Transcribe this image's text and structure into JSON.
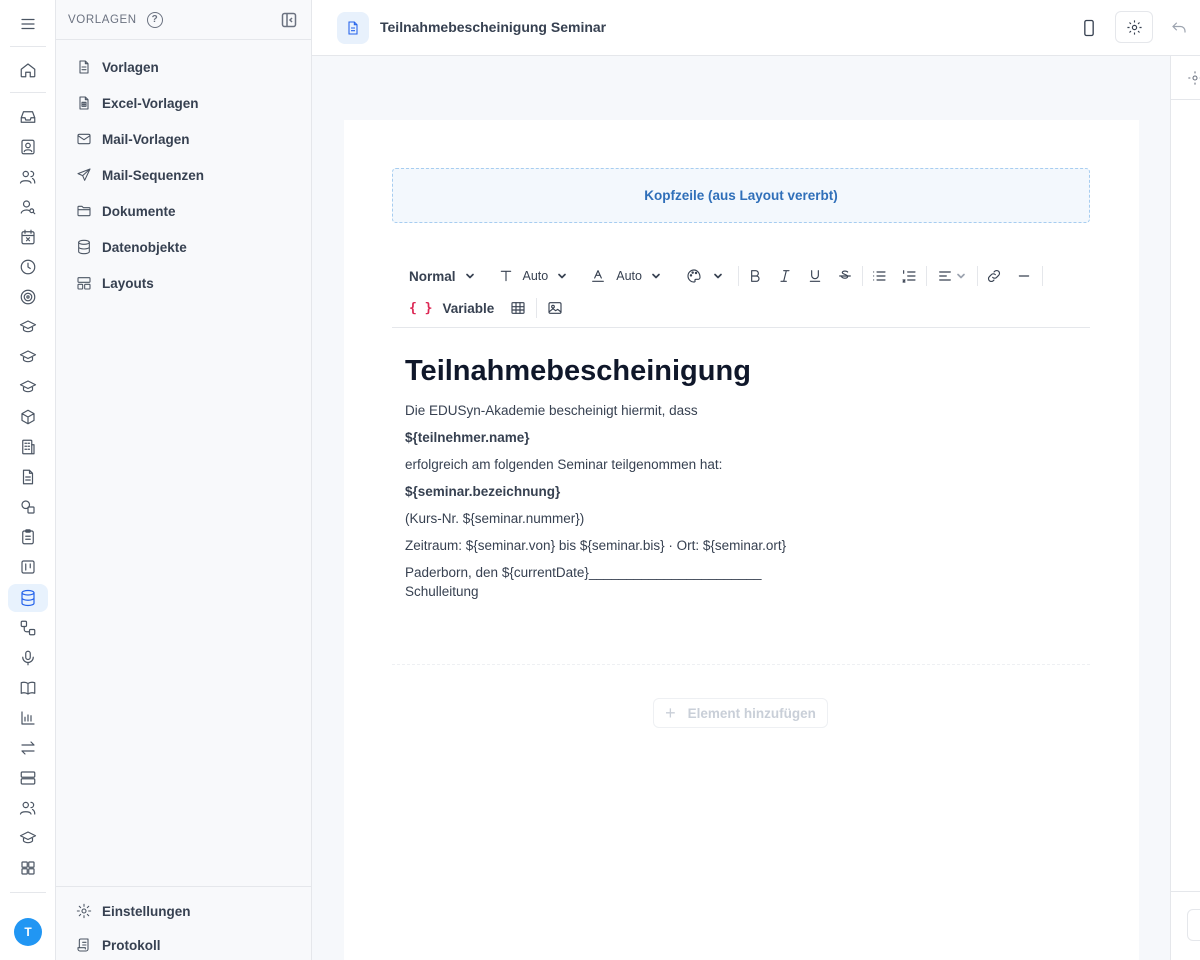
{
  "app": {
    "user_initial": "T"
  },
  "rail": {
    "items": [
      "menu",
      "home",
      "inbox",
      "contacts",
      "users",
      "user-search",
      "calendar",
      "clock",
      "target",
      "course",
      "course",
      "course",
      "package",
      "building",
      "document",
      "shapes",
      "clipboard",
      "kanban",
      "database",
      "workflow",
      "microphone",
      "book",
      "chart",
      "transfer",
      "server",
      "team",
      "course",
      "grid"
    ],
    "active": "database"
  },
  "sidebar": {
    "title": "VORLAGEN",
    "items": [
      {
        "label": "Vorlagen",
        "icon": "document-icon"
      },
      {
        "label": "Excel-Vorlagen",
        "icon": "spreadsheet-icon"
      },
      {
        "label": "Mail-Vorlagen",
        "icon": "mail-icon"
      },
      {
        "label": "Mail-Sequenzen",
        "icon": "send-icon"
      },
      {
        "label": "Dokumente",
        "icon": "folder-icon"
      },
      {
        "label": "Datenobjekte",
        "icon": "database-icon"
      },
      {
        "label": "Layouts",
        "icon": "layout-icon"
      }
    ],
    "footer": [
      {
        "label": "Einstellungen",
        "icon": "gear-icon"
      },
      {
        "label": "Protokoll",
        "icon": "scroll-icon"
      }
    ]
  },
  "topbar": {
    "title": "Teilnahmebescheinigung Seminar"
  },
  "editor": {
    "header_zone": "Kopfzeile (aus Layout vererbt)",
    "toolbar": {
      "block_type": "Normal",
      "font_size": "Auto",
      "text_color": "Auto",
      "variable_label": "Variable"
    },
    "content": {
      "heading": "Teilnahmebescheinigung",
      "line1": "Die EDUSyn-Akademie bescheinigt hiermit, dass",
      "line2": "${teilnehmer.name}",
      "line3": "erfolgreich am folgenden Seminar teilgenommen hat:",
      "line4": "${seminar.bezeichnung}",
      "line5": "(Kurs-Nr. ${seminar.nummer})",
      "line6": "Zeitraum: ${seminar.von} bis ${seminar.bis} · Ort: ${seminar.ort}",
      "line7": "Paderborn, den ${currentDate}_______________________",
      "line8": "Schulleitung"
    },
    "add_element": "Element hinzufügen"
  }
}
